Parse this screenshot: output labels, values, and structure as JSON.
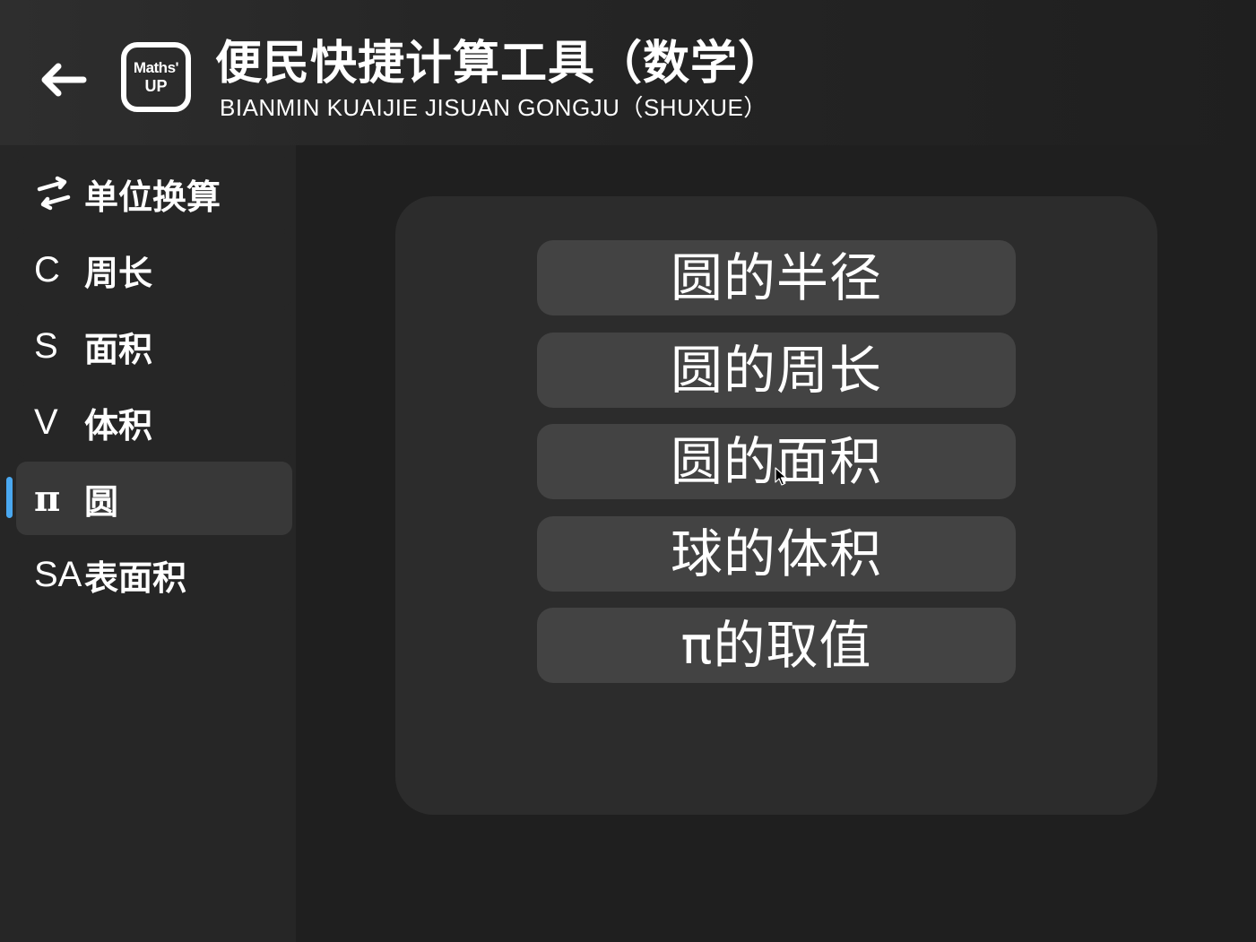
{
  "header": {
    "back_icon": "arrow-left-icon",
    "logo_line1": "Maths'",
    "logo_line2": "UP",
    "title": "便民快捷计算工具（数学）",
    "subtitle": "BIANMIN KUAIJIE JISUAN GONGJU（SHUXUE）"
  },
  "sidebar": {
    "items": [
      {
        "symbol": "⇄",
        "symbol_icon": "swap-arrows-icon",
        "label": "单位换算",
        "selected": false
      },
      {
        "symbol": "C",
        "label": "周长",
        "selected": false
      },
      {
        "symbol": "S",
        "label": "面积",
        "selected": false
      },
      {
        "symbol": "V",
        "label": "体积",
        "selected": false
      },
      {
        "symbol": "π",
        "label": "圆",
        "selected": true
      },
      {
        "symbol": "SA",
        "label": "表面积",
        "selected": false
      }
    ],
    "accent_color": "#4aa8f0"
  },
  "main": {
    "options": [
      {
        "label": "圆的半径"
      },
      {
        "label": "圆的周长"
      },
      {
        "label": "圆的面积"
      },
      {
        "label": "球的体积"
      },
      {
        "label": "π的取值"
      }
    ]
  },
  "colors": {
    "background": "#1f1f1f",
    "sidebar": "#262626",
    "selected_item": "#383838",
    "panel": "#2c2c2c",
    "button": "#434343"
  }
}
